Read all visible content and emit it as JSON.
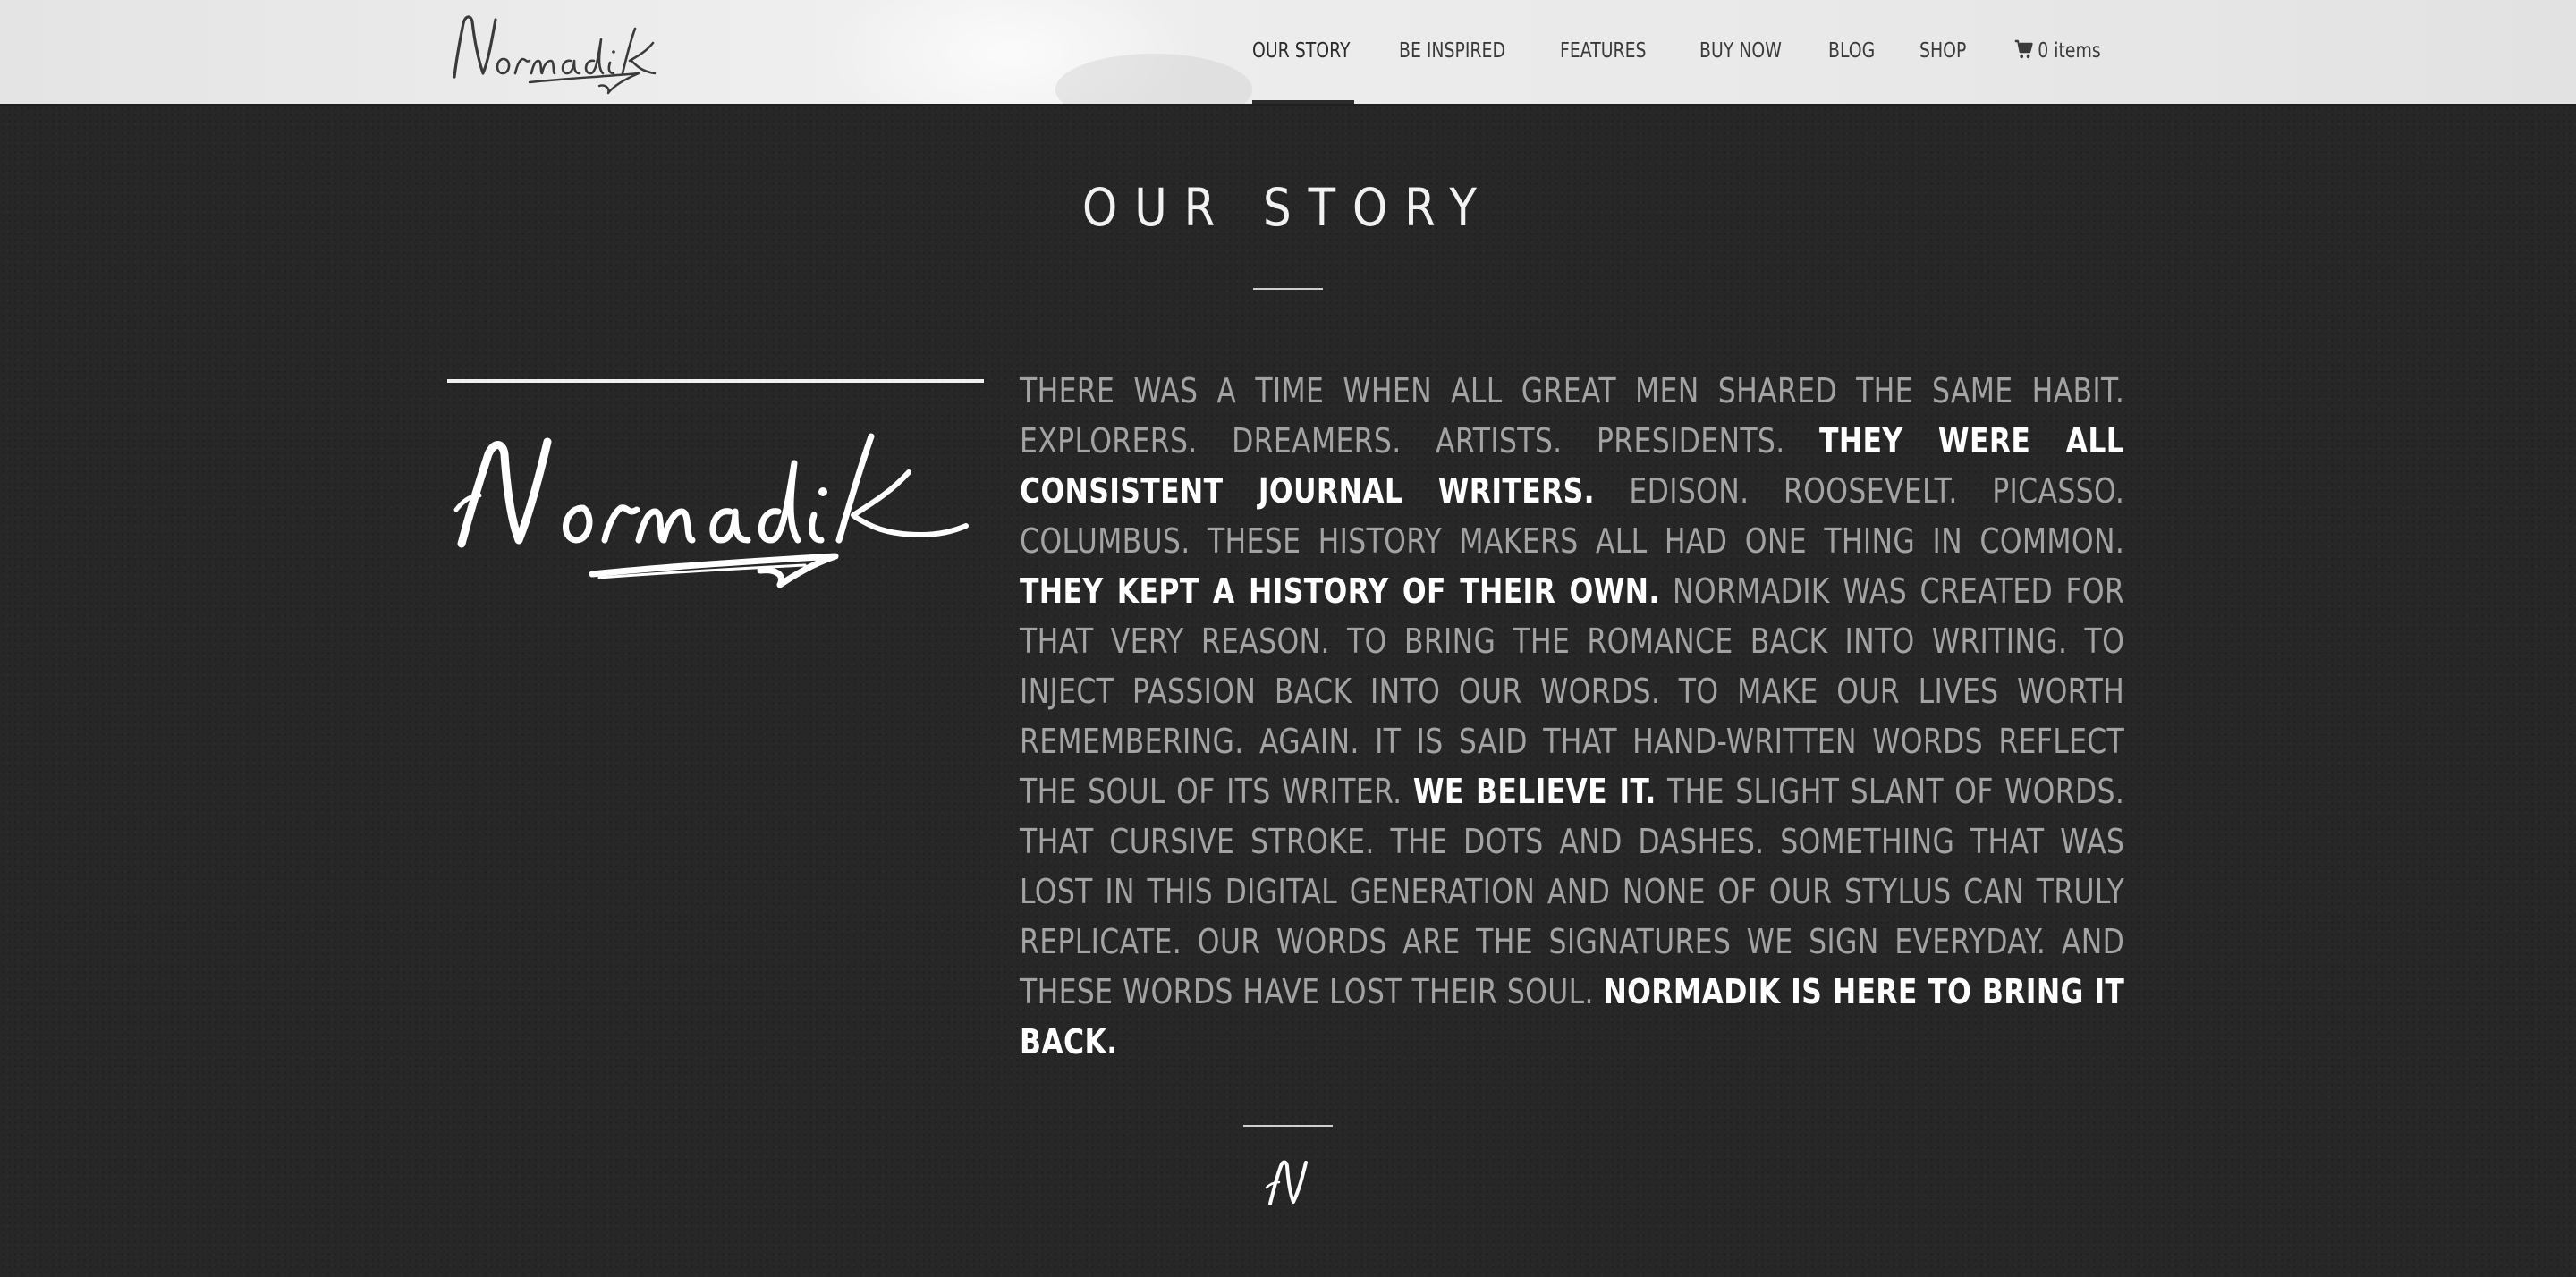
{
  "header": {
    "logo_alt": "Normadik",
    "nav": [
      {
        "label": "OUR STORY",
        "active": true
      },
      {
        "label": "BE INSPIRED"
      },
      {
        "label": "FEATURES"
      },
      {
        "label": "BUY NOW"
      },
      {
        "label": "BLOG"
      },
      {
        "label": "SHOP"
      }
    ],
    "cart": {
      "icon": "shopping-cart-icon",
      "label": "0 items"
    }
  },
  "main": {
    "title": "OUR STORY",
    "logo_text": "Normadik",
    "story": [
      {
        "text": "There was a time when all great men shared the same habit. Explorers. Dreamers. Artists. Presidents. ",
        "highlight": false
      },
      {
        "text": "They were all consistent journal writers.",
        "highlight": true
      },
      {
        "text": " Edison. Roosevelt. Picasso. Columbus. These history makers all had one thing in common. ",
        "highlight": false
      },
      {
        "text": "They kept a history of their own.",
        "highlight": true
      },
      {
        "text": " Normadik was created for that very reason. To bring the romance back into writing. To inject passion back into our words. To make our lives worth remembering. Again. It is said that hand-written words reflect the soul of its writer. ",
        "highlight": false
      },
      {
        "text": "We believe it.",
        "highlight": true
      },
      {
        "text": " The slight slant of words. That cursive stroke. The dots and dashes. Something that was lost in this digital generation and none of our stylus can truly replicate. Our words are the signatures we sign everyday. And these words have lost their soul. ",
        "highlight": false
      },
      {
        "text": "Normadik is here to bring it back.",
        "highlight": true
      }
    ],
    "footer_logo_text": "N"
  },
  "colors": {
    "background": "#272727",
    "header_bg": "#ececec",
    "nav_text": "#3a3a3a",
    "body_text": "#a3a3a3",
    "highlight_text": "#ffffff"
  }
}
